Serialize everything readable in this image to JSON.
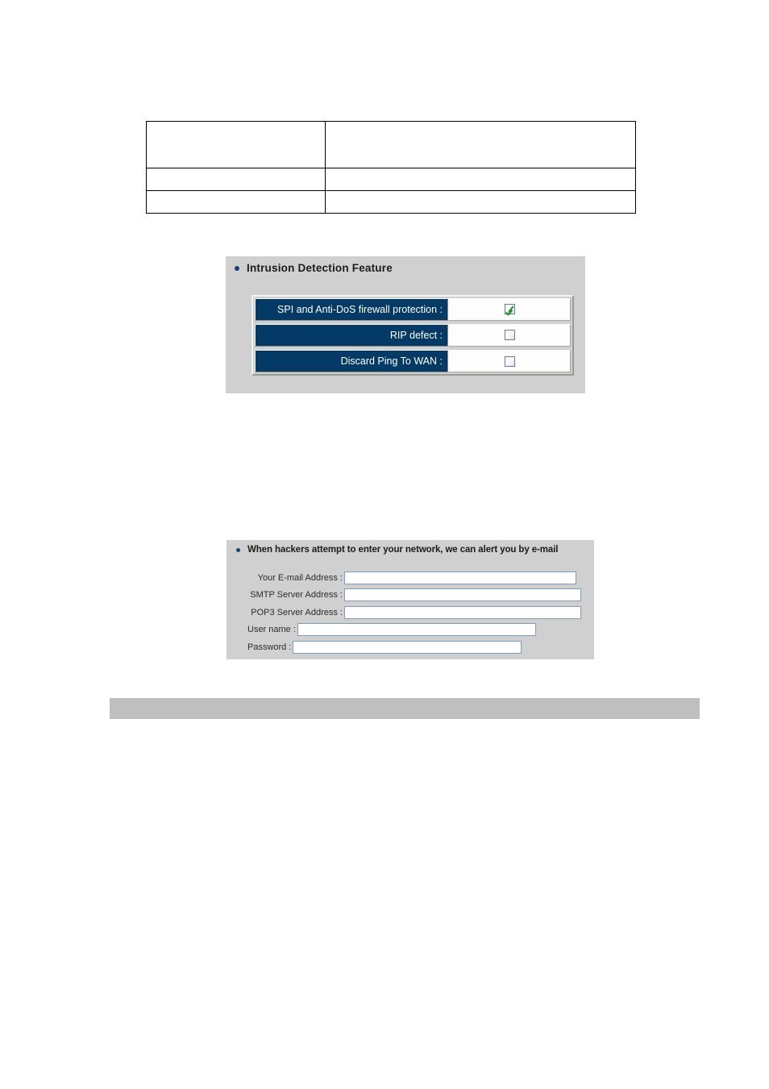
{
  "document": {
    "spec_table": {
      "rows": [
        {
          "label": "",
          "value": "",
          "tall": true
        },
        {
          "label": "",
          "value": "",
          "tall": false
        },
        {
          "label": "",
          "value": "",
          "tall": false
        }
      ]
    },
    "footer_bar": {
      "text": ""
    }
  },
  "intrusion_panel": {
    "heading": "Intrusion Detection Feature",
    "bullet_color": "#1c3f7a",
    "label_bg": "#043a66",
    "panel_bg": "#d0d0d0",
    "rows": [
      {
        "label": "SPI and Anti-DoS firewall protection :",
        "checked": true
      },
      {
        "label": "RIP defect :",
        "checked": false
      },
      {
        "label": "Discard Ping To WAN :",
        "checked": false
      }
    ]
  },
  "email_panel": {
    "heading": "When hackers attempt to enter your network, we can alert you by e-mail",
    "bullet_color": "#1c3f7a",
    "panel_bg": "#d0d0d0",
    "fields": [
      {
        "label": "Your E-mail Address :",
        "value": "",
        "placeholder": ""
      },
      {
        "label": "SMTP Server Address :",
        "value": "",
        "placeholder": ""
      },
      {
        "label": "POP3 Server Address :",
        "value": "",
        "placeholder": ""
      },
      {
        "label": "User name :",
        "value": "",
        "placeholder": ""
      },
      {
        "label": "Password :",
        "value": "",
        "placeholder": ""
      }
    ]
  }
}
